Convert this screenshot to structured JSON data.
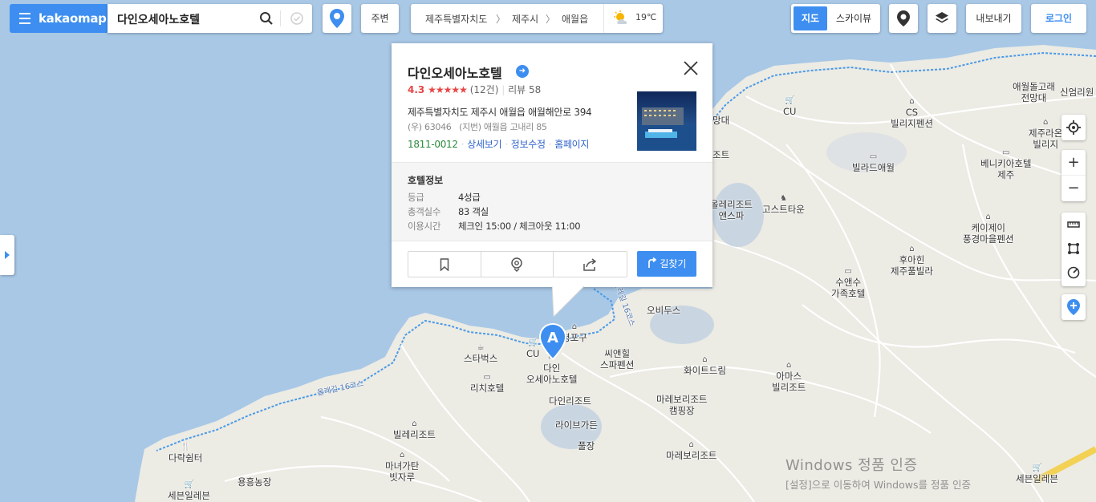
{
  "app": {
    "brand": "kakaomap",
    "search_value": "다인오세아노호텔",
    "nearby_button": "주변",
    "breadcrumb": [
      "제주특별자치도",
      "제주시",
      "애월읍"
    ],
    "weather": "19℃",
    "map_type": {
      "active": "지도",
      "inactive": "스카이뷰"
    },
    "export_button": "내보내기",
    "login_button": "로그인",
    "colors": {
      "accent": "#3d8ef0",
      "sea": "#a8c8e6",
      "land": "#ecebe4"
    }
  },
  "place": {
    "name": "다인오세아노호텔",
    "rating": "4.3",
    "stars": "★★★★★",
    "review_count": "(12건)",
    "review": "리뷰 58",
    "address": "제주특별자치도 제주시 애월읍 애월해안로 394",
    "address_sub": "(우) 63046   (지번) 애월읍 고내리 85",
    "phone": "1811-0012",
    "links": [
      "상세보기",
      "정보수정",
      "홈페이지"
    ],
    "info_title": "호텔정보",
    "info": [
      {
        "key": "등급",
        "value": "4성급"
      },
      {
        "key": "총객실수",
        "value": "83 객실"
      },
      {
        "key": "이용시간",
        "value": "체크인 15:00 / 체크아웃 11:00"
      }
    ],
    "route_button": "길찾기",
    "marker_letter": "A"
  },
  "map_labels": [
    {
      "text": "CU",
      "icon": "store"
    },
    {
      "text": "CS\n빌리지펜션",
      "icon": "lodging"
    },
    {
      "text": "애월돌고래\n전망대",
      "icon": ""
    },
    {
      "text": "신엄리원",
      "icon": ""
    },
    {
      "text": "제주라온\n빌리지",
      "icon": "lodging"
    },
    {
      "text": "망대",
      "icon": ""
    },
    {
      "text": "조트",
      "icon": ""
    },
    {
      "text": "빌라드애월",
      "icon": "hotel"
    },
    {
      "text": "베니키아호텔\n제주",
      "icon": "hotel"
    },
    {
      "text": "올레리조트\n앤스파",
      "icon": ""
    },
    {
      "text": "고스트타운",
      "icon": "attraction"
    },
    {
      "text": "케이제이\n풍경마을펜션",
      "icon": "lodging"
    },
    {
      "text": "후아힌\n제주풀빌라",
      "icon": "lodging"
    },
    {
      "text": "수앤수\n가족호텔",
      "icon": "hotel"
    },
    {
      "text": "오비두스",
      "icon": ""
    },
    {
      "text": "평포구",
      "icon": "lodging"
    },
    {
      "text": "CU",
      "icon": "store"
    },
    {
      "text": "스타벅스",
      "icon": "cafe"
    },
    {
      "text": "리치호텔",
      "icon": "hotel"
    },
    {
      "text": "다인\n오세아노호텔",
      "icon": "hotel"
    },
    {
      "text": "씨앤힐\n스파펜션",
      "icon": ""
    },
    {
      "text": "화이트드림",
      "icon": "lodging"
    },
    {
      "text": "아마스\n빌리조트",
      "icon": "lodging"
    },
    {
      "text": "다인리조트",
      "icon": ""
    },
    {
      "text": "마레보리조트\n캠핑장",
      "icon": ""
    },
    {
      "text": "라이브가든",
      "icon": ""
    },
    {
      "text": "빌레리조트",
      "icon": "lodging"
    },
    {
      "text": "풀장",
      "icon": ""
    },
    {
      "text": "마레보리조트",
      "icon": "lodging"
    },
    {
      "text": "다락쉼터",
      "icon": "restaurant"
    },
    {
      "text": "마녀가탄\n빗자루",
      "icon": "lodging"
    },
    {
      "text": "용흥농장",
      "icon": ""
    },
    {
      "text": "세븐일레븐",
      "icon": "store"
    },
    {
      "text": "세븐일레븐",
      "icon": "store"
    }
  ],
  "trails": [
    "올레길 16코스",
    "올레길 16코스"
  ],
  "watermark": {
    "line1": "Windows 정품 인증",
    "line2": "[설정]으로 이동하여 Windows를 정품 인증"
  }
}
